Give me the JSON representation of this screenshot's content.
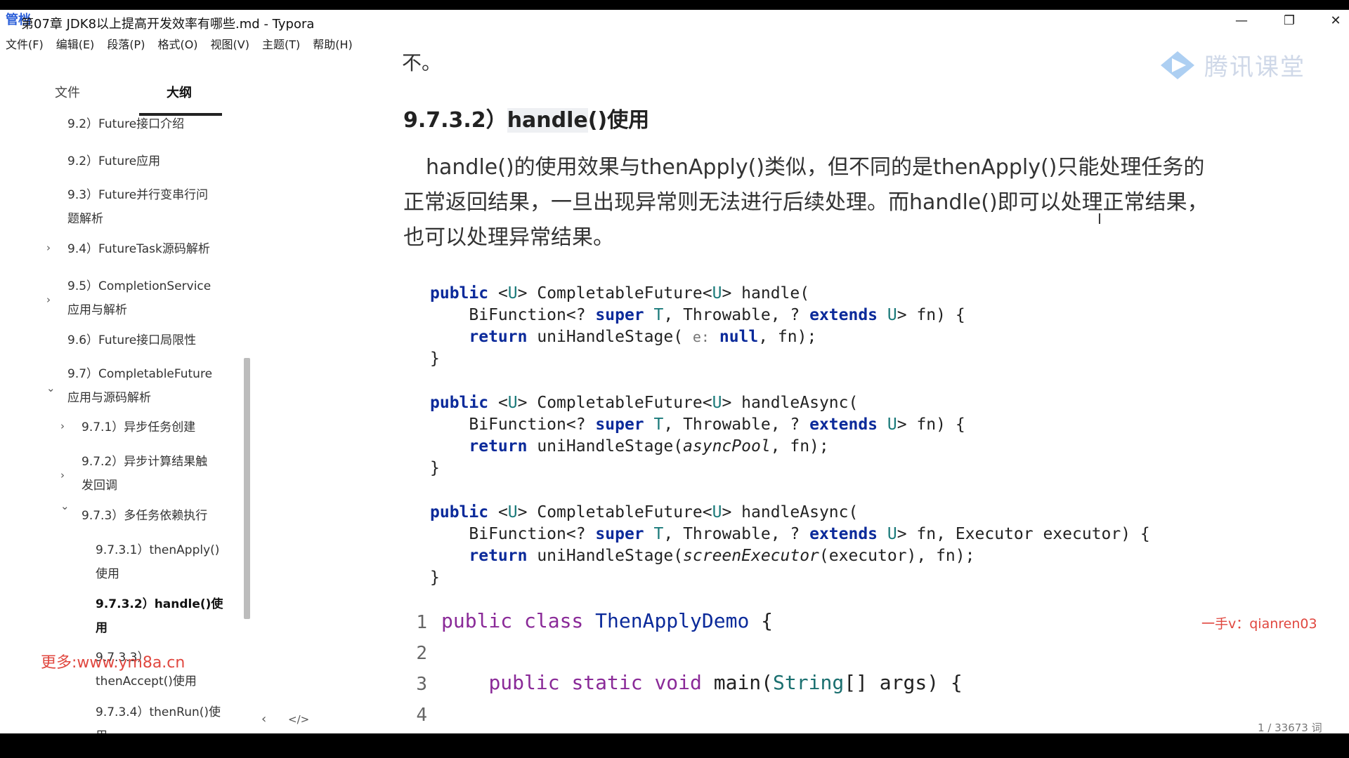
{
  "window": {
    "app_icon_text": "管档",
    "title": "第07章 JDK8以上提高开发效率有哪些.md - Typora",
    "controls": {
      "minimize": "—",
      "maximize": "❐",
      "close": "✕"
    }
  },
  "menu": [
    "文件(F)",
    "编辑(E)",
    "段落(P)",
    "格式(O)",
    "视图(V)",
    "主题(T)",
    "帮助(H)"
  ],
  "sidebar": {
    "tabs": {
      "files": "文件",
      "outline": "大纲"
    },
    "outline": [
      {
        "l1": "9.2）Future接口介绍"
      },
      {
        "l1": "9.2）Future应用"
      },
      {
        "l1": "9.3）Future并行变串行问",
        "l2": "题解析"
      },
      {
        "l1": "9.4）FutureTask源码解析"
      },
      {
        "l1": "9.5）CompletionService",
        "l2": "应用与解析"
      },
      {
        "l1": "9.6）Future接口局限性"
      },
      {
        "l1": "9.7）CompletableFuture",
        "l2": "应用与源码解析"
      },
      {
        "l1": "9.7.1）异步任务创建"
      },
      {
        "l1": "9.7.2）异步计算结果触",
        "l2": "发回调"
      },
      {
        "l1": "9.7.3）多任务依赖执行"
      },
      {
        "l1": "9.7.3.1）thenApply()",
        "l2": "使用"
      },
      {
        "l1": "9.7.3.2）handle()使",
        "l2": "用"
      },
      {
        "l1": "9.7.3.3）",
        "l2": "thenAccept()使用"
      },
      {
        "l1": "9.7.3.4）thenRun()使",
        "l2": "用"
      }
    ],
    "bottom": {
      "back": "‹",
      "source": "</>"
    }
  },
  "watermarks": {
    "left": "更多:www.ym8a.cn",
    "right": "一手v：qianren03",
    "logo": "腾讯课堂"
  },
  "editor": {
    "cut_text": "不。",
    "heading_prefix": "9.7.3.2）",
    "heading_hl": "handle",
    "heading_suffix": "()使用",
    "paragraph": "handle()的使用效果与thenApply()类似，但不同的是thenApply()只能处理任务的正常返回结果，一旦出现异常则无法进行后续处理。而handle()即可以处理正常结果，也可以处理异常结果。",
    "code": {
      "b1l1a": "public",
      "b1l1b": " <",
      "b1l1c": "U",
      "b1l1d": "> CompletableFuture<",
      "b1l1e": "U",
      "b1l1f": "> handle(",
      "b1l2a": "    BiFunction<? ",
      "b1l2b": "super",
      "b1l2c": " ",
      "b1l2d": "T",
      "b1l2e": ", Throwable, ? ",
      "b1l2f": "extends",
      "b1l2g": " ",
      "b1l2h": "U",
      "b1l2i": "> fn) {",
      "b1l3a": "    ",
      "b1l3b": "return",
      "b1l3c": " uniHandleStage( ",
      "b1l3d": "e:",
      "b1l3e": " ",
      "b1l3f": "null",
      "b1l3g": ", fn);",
      "b1l4": "}",
      "b2l1f": "> handleAsync(",
      "b2l3c": " uniHandleStage(",
      "b2l3d": "asyncPool",
      "b2l3e": ", fn);",
      "b3l2i": "> fn, Executor executor) {",
      "b3l3d": "screenExecutor",
      "b3l3e": "(executor), fn);"
    },
    "numbered": {
      "n1": "1",
      "n2": "2",
      "n3": "3",
      "n4": "4",
      "c1a": "public class",
      "c1b": " ",
      "c1c": "ThenApplyDemo",
      "c1d": " {",
      "c3a": "    ",
      "c3b": "public static void",
      "c3c": " main(",
      "c3d": "String",
      "c3e": "[] args) {"
    }
  },
  "status": {
    "wordcount": "1 / 33673 词"
  }
}
